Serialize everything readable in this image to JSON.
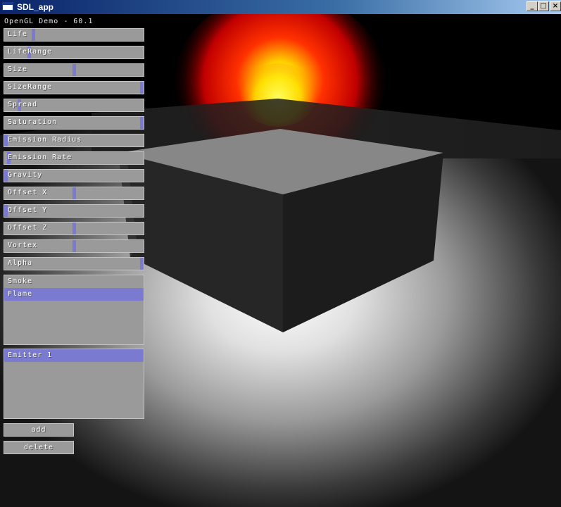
{
  "window": {
    "title": "SDL_app",
    "minimize_glyph": "_",
    "maximize_glyph": "□",
    "close_glyph": "×"
  },
  "overlay": {
    "fps_text": "OpenGL Demo - 60.1"
  },
  "sliders": [
    {
      "label": "Life",
      "value": 0.2
    },
    {
      "label": "LifeRange",
      "value": 0.17
    },
    {
      "label": "Size",
      "value": 0.5
    },
    {
      "label": "SizeRange",
      "value": 1.0
    },
    {
      "label": "Spread",
      "value": 0.1
    },
    {
      "label": "Saturation",
      "value": 1.0
    },
    {
      "label": "Emission Radius",
      "value": 0.0
    },
    {
      "label": "Emission Rate",
      "value": 0.02
    },
    {
      "label": "Gravity",
      "value": 0.0
    },
    {
      "label": "Offset X",
      "value": 0.5
    },
    {
      "label": "Offset Y",
      "value": 0.0
    },
    {
      "label": "Offset Z",
      "value": 0.5
    },
    {
      "label": "Vortex",
      "value": 0.5
    },
    {
      "label": "Alpha",
      "value": 1.0
    }
  ],
  "effect_list": {
    "items": [
      "Smoke",
      "Flame"
    ],
    "selected": 1
  },
  "emitter_list": {
    "items": [
      "Emitter 1"
    ],
    "selected": 0
  },
  "buttons": {
    "add": "add",
    "delete": "delete"
  },
  "colors": {
    "accent": "#7a7ad0",
    "panel": "#9a9a9a"
  }
}
